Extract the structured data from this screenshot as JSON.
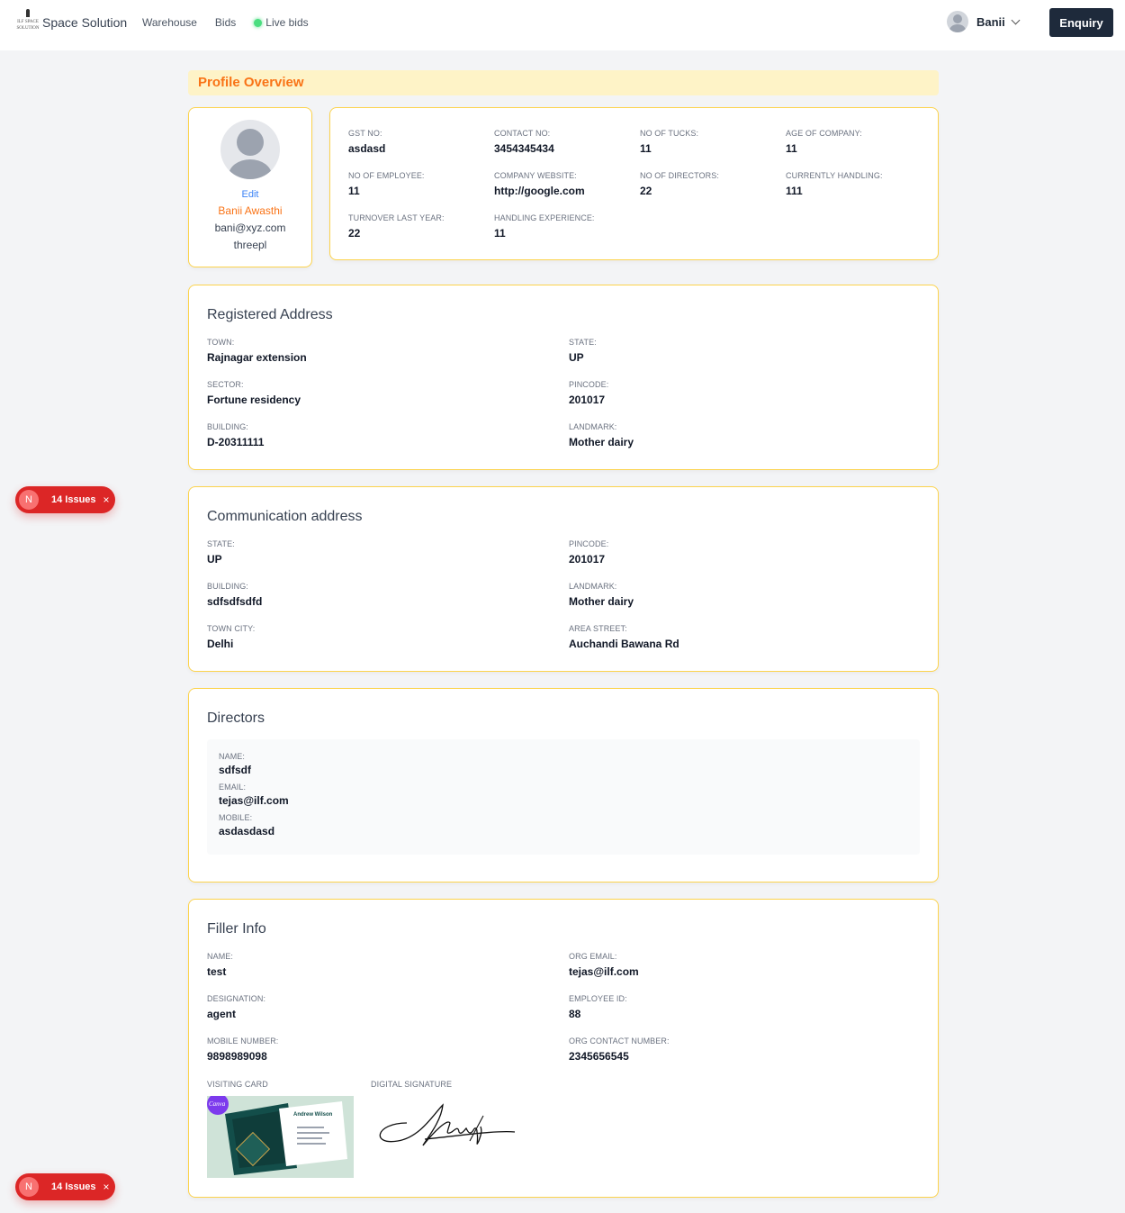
{
  "header": {
    "logo_small_1": "ILF SPACE",
    "logo_small_2": "SOLUTION",
    "logo_text": "Space Solution",
    "nav": [
      "Warehouse",
      "Bids",
      "Live bids"
    ],
    "user_name": "Banii",
    "enquiry_label": "Enquiry"
  },
  "banner": {
    "title": "Profile Overview"
  },
  "profile": {
    "edit_label": "Edit",
    "name": "Banii Awasthi",
    "email": "bani@xyz.com",
    "role": "threepl"
  },
  "company": {
    "fields": [
      {
        "label": "GST NO:",
        "value": "asdasd"
      },
      {
        "label": "CONTACT NO:",
        "value": "3454345434"
      },
      {
        "label": "NO OF TUCKS:",
        "value": "11"
      },
      {
        "label": "AGE OF COMPANY:",
        "value": "11"
      },
      {
        "label": "NO OF EMPLOYEE:",
        "value": "11"
      },
      {
        "label": "COMPANY WEBSITE:",
        "value": "http://google.com"
      },
      {
        "label": "NO OF DIRECTORS:",
        "value": "22"
      },
      {
        "label": "CURRENTLY HANDLING:",
        "value": "111"
      },
      {
        "label": "TURNOVER LAST YEAR:",
        "value": "22"
      },
      {
        "label": "HANDLING EXPERIENCE:",
        "value": "11"
      }
    ]
  },
  "registered": {
    "title": "Registered Address",
    "fields": [
      {
        "label": "TOWN:",
        "value": "Rajnagar extension"
      },
      {
        "label": "STATE:",
        "value": "UP"
      },
      {
        "label": "SECTOR:",
        "value": "Fortune residency"
      },
      {
        "label": "PINCODE:",
        "value": "201017"
      },
      {
        "label": "BUILDING:",
        "value": "D-20311111"
      },
      {
        "label": "LANDMARK:",
        "value": "Mother dairy"
      }
    ]
  },
  "communication": {
    "title": "Communication address",
    "fields": [
      {
        "label": "STATE:",
        "value": "UP"
      },
      {
        "label": "PINCODE:",
        "value": "201017"
      },
      {
        "label": "BUILDING:",
        "value": "sdfsdfsdfd"
      },
      {
        "label": "LANDMARK:",
        "value": "Mother dairy"
      },
      {
        "label": "TOWN CITY:",
        "value": "Delhi"
      },
      {
        "label": "AREA STREET:",
        "value": "Auchandi Bawana Rd"
      }
    ]
  },
  "directors": {
    "title": "Directors",
    "fields": [
      {
        "label": "NAME:",
        "value": "sdfsdf"
      },
      {
        "label": "EMAIL:",
        "value": "tejas@ilf.com"
      },
      {
        "label": "MOBILE:",
        "value": "asdasdasd"
      }
    ]
  },
  "filler": {
    "title": "Filler Info",
    "fields": [
      {
        "label": "NAME:",
        "value": "test"
      },
      {
        "label": "ORG EMAIL:",
        "value": "tejas@ilf.com"
      },
      {
        "label": "DESIGNATION:",
        "value": "agent"
      },
      {
        "label": "EMPLOYEE ID:",
        "value": "88"
      },
      {
        "label": "MOBILE NUMBER:",
        "value": "9898989098"
      },
      {
        "label": "ORG CONTACT NUMBER:",
        "value": "2345656545"
      }
    ],
    "visiting_card_label": "VISITING CARD",
    "digital_signature_label": "DIGITAL SIGNATURE",
    "card_brand": "Canva",
    "card_name": "Andrew Wilson"
  },
  "issues": {
    "letter": "N",
    "label": "14 Issues",
    "close": "×"
  },
  "colors": {
    "accent": "#f97316",
    "border": "#fcd34d",
    "banner_bg": "#fef3c7",
    "button_bg": "#1e2a3b",
    "issues_bg": "#dc2626"
  }
}
